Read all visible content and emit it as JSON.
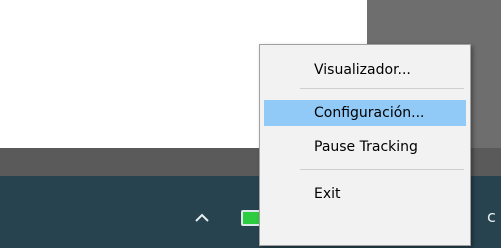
{
  "context_menu": {
    "items": [
      {
        "label": "Visualizador..."
      },
      {
        "label": "Configuración..."
      },
      {
        "label": "Pause Tracking"
      },
      {
        "label": "Exit"
      }
    ],
    "highlighted_item": "Configuración..."
  },
  "taskbar": {
    "icons": [
      "show-hidden-icons-caret",
      "green-app-icon",
      "tray-app-icon",
      "tray-app-icon",
      "wifi-icon",
      "volume-icon"
    ],
    "clock_fragment": "c"
  },
  "colors": {
    "menu_bg": "#f2f2f2",
    "highlight": "#91c9f7",
    "taskbar": "#27434f"
  }
}
